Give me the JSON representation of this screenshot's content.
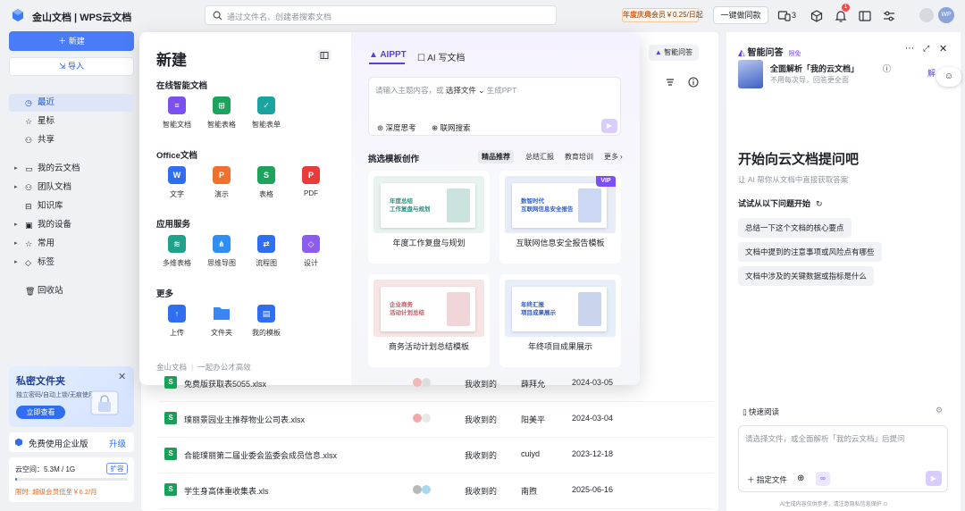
{
  "app": {
    "brand": "金山文档 | WPS云文档"
  },
  "search": {
    "placeholder": "通过文件名、创建者搜索文档"
  },
  "topbar": {
    "promo_prefix": "年度庆典",
    "promo_text": "会员￥0.25/日起",
    "oneclick": "一键做同款",
    "share_count": "3",
    "notif_count": "1",
    "avatar": "WP"
  },
  "sidebar": {
    "new_label": "新建",
    "import_label": "导入",
    "items": [
      {
        "label": "最近",
        "active": true
      },
      {
        "label": "星标"
      },
      {
        "label": "共享"
      },
      {
        "label": "我的云文档",
        "caret": true
      },
      {
        "label": "团队文档",
        "caret": true
      },
      {
        "label": "知识库"
      },
      {
        "label": "我的设备",
        "caret": true
      },
      {
        "label": "常用",
        "caret": true
      },
      {
        "label": "标签",
        "caret": true
      },
      {
        "label": "回收站"
      }
    ],
    "private": {
      "title": "私密文件夹",
      "desc": "独立密码/自动上锁/无痕使用",
      "btn": "立即查看"
    },
    "enterprise": {
      "label": "免费使用企业版",
      "upgrade": "升级"
    },
    "storage": {
      "label": "云空间：5.3M / 1G",
      "expand": "扩容",
      "progress": 0.005,
      "promo": "限时: 超级会员低至￥6.2/月"
    }
  },
  "files": [
    {
      "name": "免费版获取表5055.xlsx",
      "source": "我收到的",
      "owner": "薛拜允",
      "date": "2024-03-05"
    },
    {
      "name": "璞丽景园业主推荐物业公司表.xlsx",
      "source": "我收到的",
      "owner": "阳美平",
      "date": "2024-03-04"
    },
    {
      "name": "合能璞丽第二届业委会监委会成员信息.xlsx",
      "source": "我收到的",
      "owner": "cuiyd",
      "date": "2023-12-18"
    },
    {
      "name": "学生身高体重收集表.xls",
      "source": "我收到的",
      "owner": "南煦",
      "date": "2025-06-16"
    }
  ],
  "new_panel": {
    "title": "新建",
    "sections": [
      {
        "title": "在线智能文档",
        "items": [
          {
            "label": "智能文档",
            "color": "#7b4ff0",
            "glyph": "≡"
          },
          {
            "label": "智能表格",
            "color": "#1ea35c",
            "glyph": "⊞"
          },
          {
            "label": "智能表单",
            "color": "#1aa3a0",
            "glyph": "✓"
          }
        ]
      },
      {
        "title": "Office文档",
        "items": [
          {
            "label": "文字",
            "color": "#2f6ef0",
            "glyph": "W"
          },
          {
            "label": "演示",
            "color": "#f0702e",
            "glyph": "P"
          },
          {
            "label": "表格",
            "color": "#1ea35c",
            "glyph": "S"
          },
          {
            "label": "PDF",
            "color": "#ea3b3b",
            "glyph": "P"
          }
        ]
      },
      {
        "title": "应用服务",
        "items": [
          {
            "label": "多维表格",
            "color": "#1ea38a",
            "glyph": "≋"
          },
          {
            "label": "思维导图",
            "color": "#2f8ef0",
            "glyph": "⋔"
          },
          {
            "label": "流程图",
            "color": "#2f6ef0",
            "glyph": "⇄"
          },
          {
            "label": "设计",
            "color": "#8a5cf0",
            "glyph": "◇"
          }
        ]
      },
      {
        "title": "更多",
        "items": [
          {
            "label": "上传",
            "color": "#2f6ef0",
            "glyph": "↑"
          },
          {
            "label": "文件夹",
            "color": "#3a86f5",
            "glyph": ""
          },
          {
            "label": "我的模板",
            "color": "#2f6ef0",
            "glyph": "▤"
          }
        ]
      }
    ],
    "footer": "金山文档",
    "footer2": "一起办公才高效"
  },
  "ai_panel": {
    "tab1": "AIPPT",
    "tab2": "AI 写文档",
    "assistant": "智能问答",
    "input_prefix": "请输入主题内容，或",
    "input_select": "选择文件",
    "input_suffix": "生成PPT",
    "think": "深度思考",
    "web": "联网搜索",
    "tpl_title": "挑选模板创作",
    "tpl_tabs": [
      "精品推荐",
      "总结汇报",
      "教育培训",
      "更多"
    ],
    "templates": [
      {
        "caption": "年度工作复盘与规划",
        "t1": "年度总结",
        "t2": "工作复盘与规划",
        "bg": "#e8f3f0",
        "accent": "#2a8f7c"
      },
      {
        "caption": "互联网信息安全报告模板",
        "t1": "数智时代",
        "t2": "互联网信息安全报告",
        "bg": "#e7ecf7",
        "accent": "#2f5fd0",
        "vip": "VIP"
      },
      {
        "caption": "商务活动计划总结模板",
        "t1": "企业商务",
        "t2": "活动计划总结",
        "bg": "#f7e4e4",
        "accent": "#c25b62"
      },
      {
        "caption": "年终项目成果展示",
        "t1": "年终汇报",
        "t2": "项目成果展示",
        "bg": "#e6eefa",
        "accent": "#2d56b8"
      }
    ]
  },
  "right_panel": {
    "title": "智能问答",
    "badge": "限免",
    "promo_title": "全面解析「我的云文档」",
    "promo_sub": "不用每次导，回答更全面",
    "promo_btn": "解",
    "heading": "开始向云文档提问吧",
    "sub": "让 AI 帮你从文档中直接获取答案",
    "try": "试试从以下问题开始",
    "questions": [
      "总结一下这个文档的核心要点",
      "文档中提到的注意事项或风险点有哪些",
      "文档中涉及的关键数据或指标是什么"
    ],
    "quick_read": "快速阅读",
    "placeholder": "请选择文件，或全面解析「我的云文档」后提问",
    "specify": "指定文件",
    "disclaimer": "AI生成内容仅供参考，请注意隐私信息保护"
  },
  "colors": {
    "accent": "#4a7cf7",
    "ai_purple": "#7b4ff0",
    "excel": "#18a058"
  }
}
